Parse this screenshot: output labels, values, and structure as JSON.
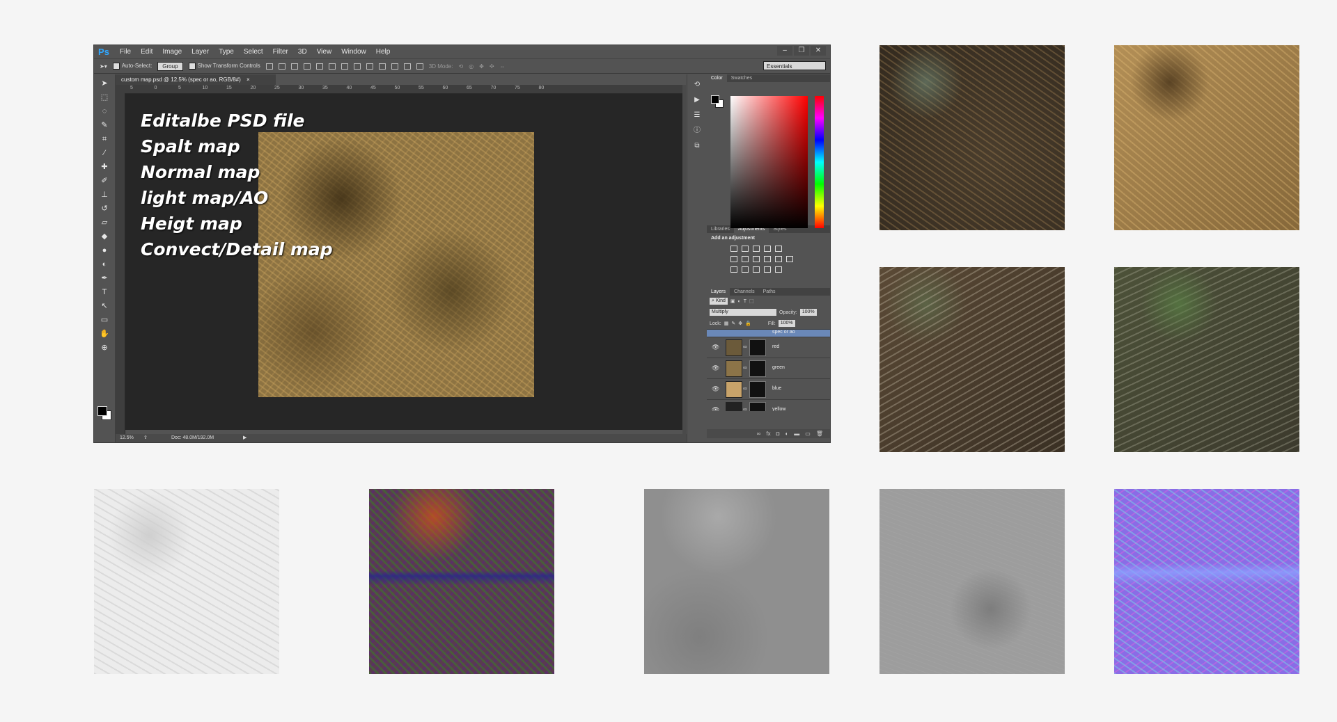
{
  "photoshop": {
    "logo": "Ps",
    "menu": [
      "File",
      "Edit",
      "Image",
      "Layer",
      "Type",
      "Select",
      "Filter",
      "3D",
      "View",
      "Window",
      "Help"
    ],
    "window_buttons": [
      "–",
      "❐",
      "✕"
    ],
    "options_bar": {
      "auto_select_label": "Auto-Select:",
      "auto_select_value": "Group",
      "transform_controls_label": "Show Transform Controls",
      "mode_3d_label": "3D Mode:",
      "workspace": "Essentials"
    },
    "document_tab": "custom map.psd @ 12.5% (spec or ao, RGB/8#)",
    "ruler_ticks": [
      "5",
      "0",
      "5",
      "10",
      "15",
      "20",
      "25",
      "30",
      "35",
      "40",
      "45",
      "50",
      "55",
      "60",
      "65",
      "70",
      "75",
      "80"
    ],
    "overlay_lines": [
      "Editalbe PSD file",
      "Spalt map",
      "Normal map",
      "light map/AO",
      "Heigt map",
      "Convect/Detail map"
    ],
    "status": {
      "zoom": "12.5%",
      "doc": "Doc: 48.0M/192.0M"
    },
    "color_panel": {
      "tabs": [
        "Color",
        "Swatches"
      ],
      "fg_color": "#000000",
      "bg_color": "#ffffff"
    },
    "adjustments_panel": {
      "tabs": [
        "Libraries",
        "Adjustments",
        "Styles"
      ],
      "title": "Add an adjustment"
    },
    "layers_panel": {
      "tabs": [
        "Layers",
        "Channels",
        "Paths"
      ],
      "filter": "Kind",
      "blend_mode": "Multiply",
      "opacity_label": "Opacity:",
      "opacity": "100%",
      "lock_label": "Lock:",
      "fill_label": "Fill:",
      "fill": "100%",
      "layers": [
        {
          "name": "spec or ao",
          "color": "#d9d9d9"
        },
        {
          "name": "red",
          "color": "#6b5a3a"
        },
        {
          "name": "green",
          "color": "#8c7448"
        },
        {
          "name": "blue",
          "color": "#c8a36a"
        },
        {
          "name": "yellow",
          "color": "#222222"
        }
      ]
    }
  }
}
